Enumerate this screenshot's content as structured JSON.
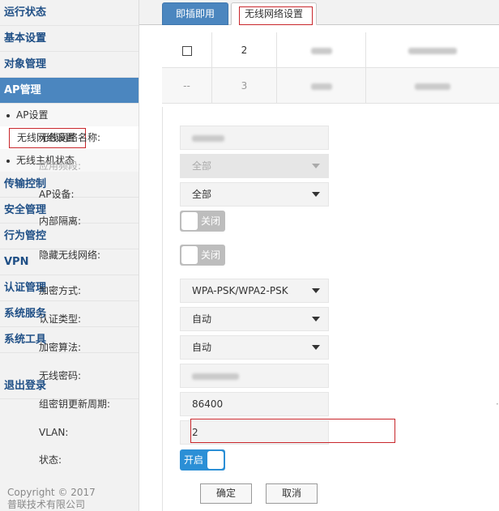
{
  "sidebar": {
    "items": [
      {
        "label": "运行状态"
      },
      {
        "label": "基本设置"
      },
      {
        "label": "对象管理"
      },
      {
        "label": "AP管理"
      }
    ],
    "sub_items": [
      {
        "label": "AP设置"
      },
      {
        "label": "无线网络设置"
      },
      {
        "label": "无线主机状态"
      }
    ],
    "items_after": [
      {
        "label": "传输控制"
      },
      {
        "label": "安全管理"
      },
      {
        "label": "行为管控"
      },
      {
        "label": "VPN"
      },
      {
        "label": "认证管理"
      },
      {
        "label": "系统服务"
      },
      {
        "label": "系统工具"
      }
    ],
    "logout": "退出登录",
    "copyright_line1": "Copyright © 2017",
    "copyright_line2": "普联技术有限公司"
  },
  "tabs": [
    {
      "label": "即插即用"
    },
    {
      "label": "无线网络设置"
    }
  ],
  "table": {
    "rows": [
      {
        "index": "2",
        "select": "checkbox"
      },
      {
        "index": "3",
        "select": "--"
      }
    ]
  },
  "form": {
    "ssid_label": "无线网络名称:",
    "band_label": "应用频段:",
    "band_value": "全部",
    "ap_label": "AP设备:",
    "ap_value": "全部",
    "isolation_label": "内部隔离:",
    "isolation_state": "关闭",
    "hide_label": "隐藏无线网络:",
    "hide_state": "关闭",
    "encryption_label": "加密方式:",
    "encryption_value": "WPA-PSK/WPA2-PSK",
    "auth_label": "认证类型:",
    "auth_value": "自动",
    "algo_label": "加密算法:",
    "algo_value": "自动",
    "password_label": "无线密码:",
    "rekey_label": "组密钥更新周期:",
    "rekey_value": "86400",
    "vlan_label": "VLAN:",
    "vlan_value": "2",
    "status_label": "状态:",
    "status_state": "开启",
    "ok_label": "确定",
    "cancel_label": "取消"
  },
  "colors": {
    "accent": "#4b86bf",
    "highlight_box": "#c8262b",
    "toggle_on": "#2b8fd6",
    "toggle_off": "#bdbdbd"
  }
}
